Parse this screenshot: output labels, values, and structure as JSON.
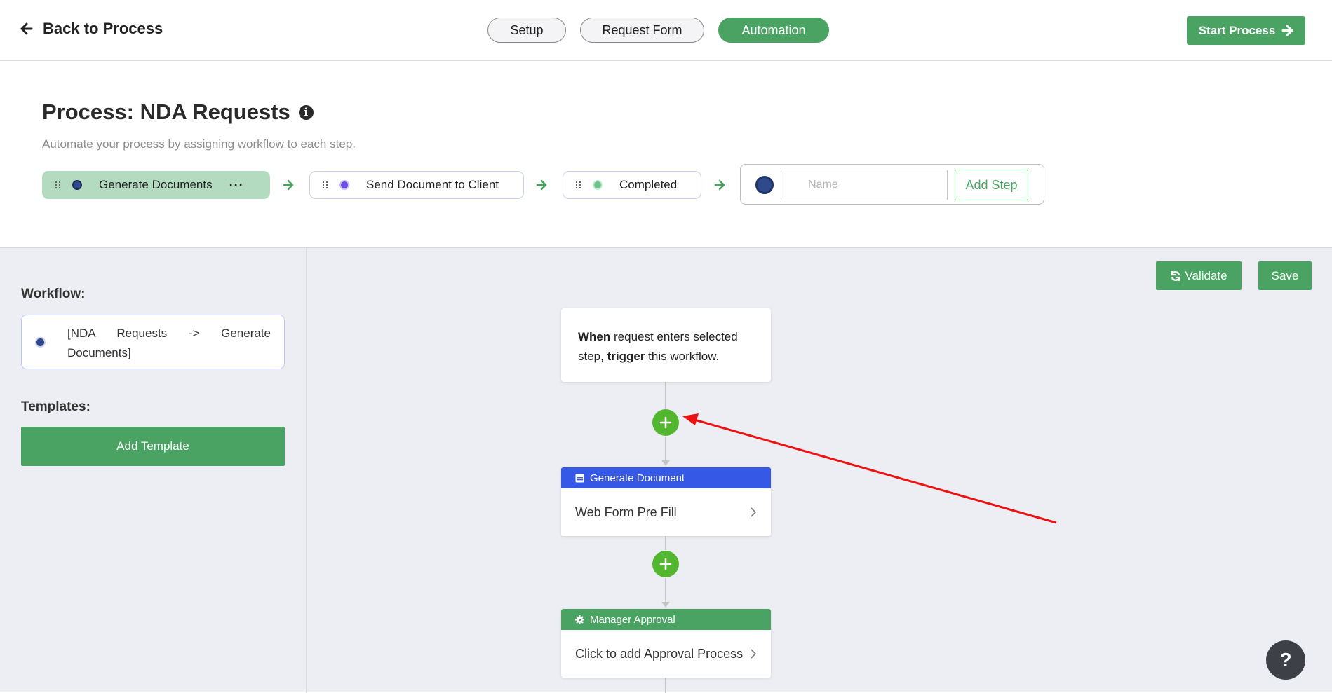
{
  "header": {
    "back_label": "Back to Process",
    "tabs": [
      {
        "label": "Setup",
        "active": false
      },
      {
        "label": "Request Form",
        "active": false
      },
      {
        "label": "Automation",
        "active": true
      }
    ],
    "start_label": "Start Process"
  },
  "process": {
    "title": "Process: NDA Requests",
    "subtitle": "Automate your process by assigning workflow to each step.",
    "steps": [
      {
        "label": "Generate Documents",
        "dot_color": "#2e4a8a",
        "active": true
      },
      {
        "label": "Send Document to Client",
        "dot_color": "#6b4de6",
        "active": false
      },
      {
        "label": "Completed",
        "dot_color": "#6cc48a",
        "active": false
      }
    ],
    "new_step": {
      "name_placeholder": "Name",
      "add_label": "Add Step"
    }
  },
  "sidebar": {
    "workflow_heading": "Workflow:",
    "workflow_item": "[NDA Requests -> Generate Documents]",
    "templates_heading": "Templates:",
    "add_template_label": "Add Template"
  },
  "canvas": {
    "validate_label": "Validate",
    "save_label": "Save",
    "trigger": {
      "when": "When",
      "text1": " request enters selected step, ",
      "trigger_word": "trigger",
      "text2": " this workflow."
    },
    "cards": [
      {
        "header": "Generate Document",
        "header_color": "#3558e6",
        "header_icon": "document-icon",
        "body": "Web Form Pre Fill"
      },
      {
        "header": "Manager Approval",
        "header_color": "#4aa363",
        "header_icon": "gear-icon",
        "body": "Click to add Approval Process"
      }
    ],
    "help_label": "?"
  },
  "colors": {
    "accent": "#4aa363",
    "plus_green": "#52b62f",
    "annotation_red": "#ee1111"
  }
}
